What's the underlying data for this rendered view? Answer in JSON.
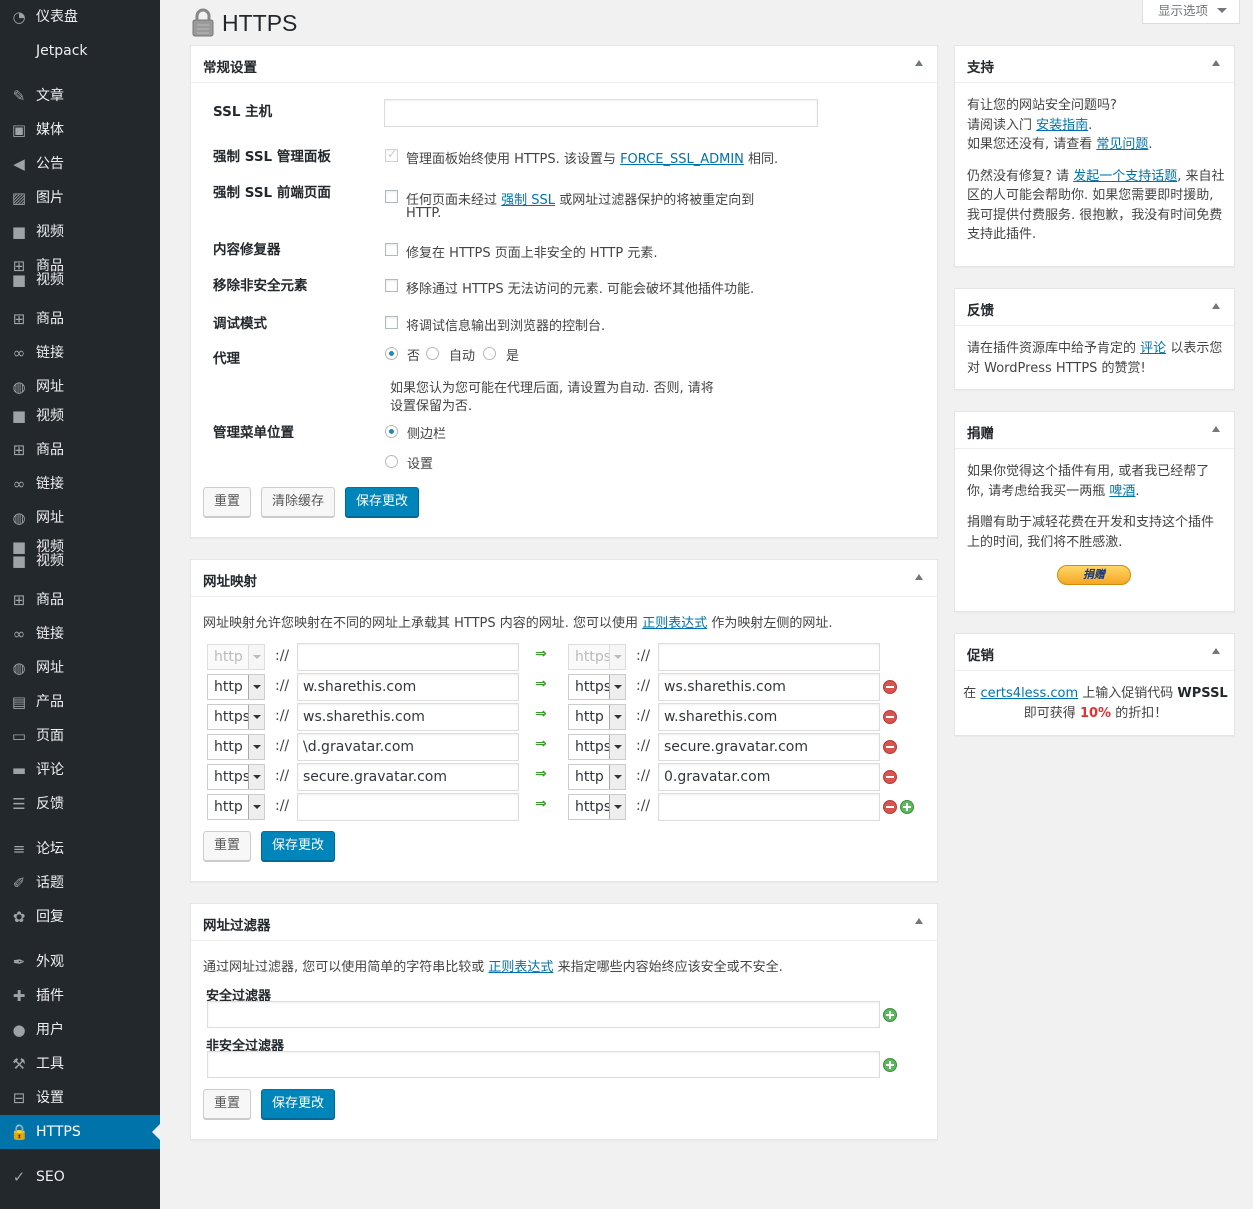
{
  "sidebar": {
    "items": [
      {
        "label": "仪表盘",
        "icon": "dashboard-icon"
      },
      {
        "label": "Jetpack",
        "icon": ""
      },
      {
        "label": "文章",
        "icon": "pin-icon"
      },
      {
        "label": "媒体",
        "icon": "media-icon"
      },
      {
        "label": "公告",
        "icon": "megaphone-icon"
      },
      {
        "label": "图片",
        "icon": "image-icon"
      },
      {
        "label": "视频",
        "icon": "video-icon"
      },
      {
        "label": "商品",
        "label2": "视频",
        "icon": "cart-icon",
        "icon2": "video-icon"
      },
      {
        "label": "商品",
        "icon": "cart-icon"
      },
      {
        "label": "链接",
        "icon": "link-icon"
      },
      {
        "label": "网址",
        "icon": "globe-icon"
      },
      {
        "label": "视频",
        "icon": "video-icon"
      },
      {
        "label": "商品",
        "icon": "cart-icon"
      },
      {
        "label": "链接",
        "icon": "link-icon"
      },
      {
        "label": "网址",
        "icon": "globe-icon"
      },
      {
        "label": "视频",
        "label2": "视频",
        "icon": "video-icon",
        "icon2": "video-icon"
      },
      {
        "label": "商品",
        "icon": "cart-icon"
      },
      {
        "label": "链接",
        "icon": "link-icon"
      },
      {
        "label": "网址",
        "icon": "globe-icon"
      },
      {
        "label": "产品",
        "icon": "product-icon"
      },
      {
        "label": "页面",
        "icon": "page-icon"
      },
      {
        "label": "评论",
        "icon": "comment-icon"
      },
      {
        "label": "反馈",
        "icon": "feedback-icon"
      },
      {
        "label": "论坛",
        "icon": "forum-icon"
      },
      {
        "label": "话题",
        "icon": "topic-icon"
      },
      {
        "label": "回复",
        "icon": "reply-icon"
      },
      {
        "label": "外观",
        "icon": "brush-icon"
      },
      {
        "label": "插件",
        "icon": "plugin-icon"
      },
      {
        "label": "用户",
        "icon": "user-icon"
      },
      {
        "label": "工具",
        "icon": "wrench-icon"
      },
      {
        "label": "设置",
        "icon": "settings-icon"
      },
      {
        "label": "HTTPS",
        "icon": "lock-icon"
      },
      {
        "label": "SEO",
        "icon": "seo-icon"
      }
    ]
  },
  "page": {
    "title": "HTTPS",
    "screen_options": "显示选项"
  },
  "general": {
    "title": "常规设置",
    "ssl_host_label": "SSL 主机",
    "ssl_host_value": "",
    "force_admin_label": "强制 SSL 管理面板",
    "force_admin_text": "管理面板始终使用 HTTPS. 该设置与",
    "force_admin_link": "FORCE_SSL_ADMIN",
    "force_admin_after": "相同.",
    "force_front_label": "强制 SSL 前端页面",
    "force_front_text": "任何页面未经过",
    "force_front_link": "强制 SSL",
    "force_front_after": "或网址过滤器保护的将被重定向到",
    "force_front_line2": "HTTP.",
    "fixer_label": "内容修复器",
    "fixer_text": "修复在 HTTPS 页面上非安全的 HTTP 元素.",
    "remove_label": "移除非安全元素",
    "remove_text": "移除通过 HTTPS 无法访问的元素. 可能会破坏其他插件功能.",
    "debug_label": "调试模式",
    "debug_text": "将调试信息输出到浏览器的控制台.",
    "proxy_label": "代理",
    "proxy_no": "否",
    "proxy_auto": "自动",
    "proxy_yes": "是",
    "proxy_help1": "如果您认为您可能在代理后面, 请设置为自动. 否则, 请将",
    "proxy_help2": "设置保留为否.",
    "menu_label": "管理菜单位置",
    "menu_sidebar": "侧边栏",
    "menu_settings": "设置",
    "reset": "重置",
    "clear_cache": "清除缓存",
    "save": "保存更改"
  },
  "mapping": {
    "title": "网址映射",
    "desc_before": "网址映射允许您映射在不同的网址上承载其 HTTPS 内容的网址. 您可以使用",
    "desc_link": "正则表达式",
    "desc_after": "作为映射左侧的网址.",
    "sep": "://",
    "arrow": "⇒",
    "rows": [
      {
        "lp": "http",
        "lh": "",
        "rp": "https",
        "rh": ""
      },
      {
        "lp": "http",
        "lh": "w.sharethis.com",
        "rp": "https",
        "rh": "ws.sharethis.com"
      },
      {
        "lp": "https",
        "lh": "ws.sharethis.com",
        "rp": "http",
        "rh": "w.sharethis.com"
      },
      {
        "lp": "http",
        "lh": "\\d.gravatar.com",
        "rp": "https",
        "rh": "secure.gravatar.com"
      },
      {
        "lp": "https",
        "lh": "secure.gravatar.com",
        "rp": "http",
        "rh": "0.gravatar.com"
      },
      {
        "lp": "http",
        "lh": "",
        "rp": "https",
        "rh": ""
      }
    ],
    "reset": "重置",
    "save": "保存更改"
  },
  "filters": {
    "title": "网址过滤器",
    "desc_before": "通过网址过滤器, 您可以使用简单的字符串比较或",
    "desc_link": "正则表达式",
    "desc_after": "来指定哪些内容始终应该安全或不安全.",
    "secure_label": "安全过滤器",
    "secure_value": "",
    "unsecure_label": "非安全过滤器",
    "unsecure_value": "",
    "reset": "重置",
    "save": "保存更改"
  },
  "support": {
    "title": "支持",
    "l1": "有让您的网站安全问题吗?",
    "l2_before": "请阅读入门",
    "l2_link": "安装指南",
    "l2_after": ".",
    "l3_before": "如果您还没有, 请查看",
    "l3_link": "常见问题",
    "l3_after": ".",
    "p2_l1_before": "仍然没有修复? 请",
    "p2_l1_link": "发起一个支持话题",
    "p2_l1_after": ", 来自社",
    "p2_l2": "区的人可能会帮助你. 如果您需要即时援助,",
    "p2_l3": "我可提供付费服务. 很抱歉，我没有时间免费",
    "p2_l4": "支持此插件."
  },
  "feedback": {
    "title": "反馈",
    "l1_before": "请在插件资源库中给予肯定的",
    "l1_link": "评论",
    "l1_after": "以表示您",
    "l2": "对 WordPress HTTPS 的赞赏!"
  },
  "donate": {
    "title": "捐赠",
    "l1": "如果你觉得这个插件有用, 或者我已经帮了",
    "l2_before": "你, 请考虑给我买一两瓶",
    "l2_link": "啤酒",
    "l2_after": ".",
    "l3": "捐赠有助于减轻花费在开发和支持这个插件",
    "l4": "上的时间, 我们将不胜感激.",
    "button": "捐赠"
  },
  "promo": {
    "title": "促销",
    "l1_before": "在",
    "l1_link": "certs4less.com",
    "l1_mid": "上输入促销代码",
    "l1_code": "WPSSL",
    "l2_before": "即可获得",
    "l2_pct": "10%",
    "l2_after": "的折扣！"
  },
  "colors": {
    "sidebar_bg": "#23282d",
    "accent": "#0073aa",
    "primary_button": "#0085ba",
    "promo_red": "#dd3333"
  }
}
